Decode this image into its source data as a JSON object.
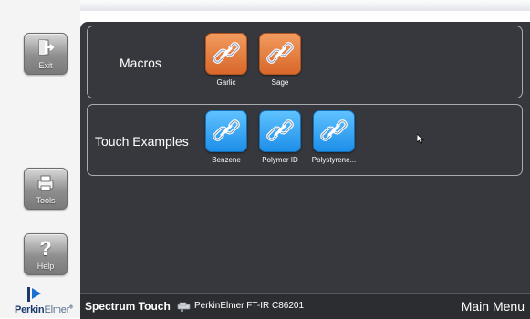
{
  "sidebar": {
    "exit_label": "Exit",
    "tools_label": "Tools",
    "help_label": "Help",
    "help_glyph": "?",
    "logo_perkin": "Perkin",
    "logo_elmer": "Elmer",
    "logo_mark": "®"
  },
  "groups": [
    {
      "title": "Macros",
      "items": [
        {
          "label": "Garlic",
          "color": "#e57a3c"
        },
        {
          "label": "Sage",
          "color": "#e57a3c"
        }
      ]
    },
    {
      "title": "Touch Examples",
      "items": [
        {
          "label": "Benzene",
          "color": "#2ea3f7"
        },
        {
          "label": "Polymer ID",
          "color": "#2ea3f7"
        },
        {
          "label": "Polystyrene...",
          "color": "#2ea3f7"
        }
      ]
    }
  ],
  "status_bar": {
    "app_name": "Spectrum Touch",
    "instrument": "PerkinElmer FT-IR C86201",
    "screen_title": "Main Menu"
  },
  "icons": [
    "exit-door-icon",
    "tools-printer-icon",
    "help-question-icon",
    "link-chain-icon",
    "instrument-icon",
    "mouse-cursor-icon"
  ]
}
